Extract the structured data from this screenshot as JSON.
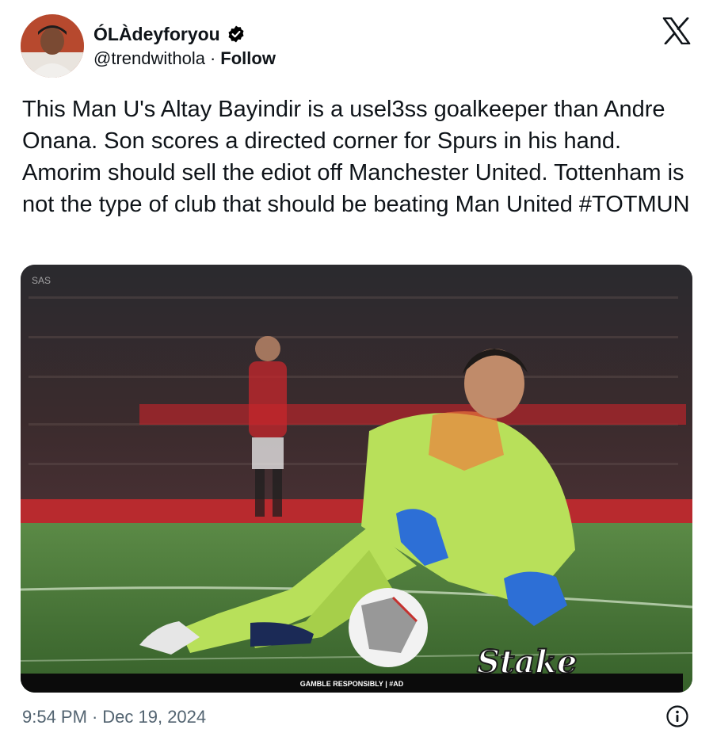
{
  "author": {
    "display_name": "ÓLÀdeyforyou",
    "handle": "@trendwithola",
    "separator": "·",
    "follow_label": "Follow",
    "verified": true,
    "avatar_icon": "user-avatar"
  },
  "tweet": {
    "text": "This Man U's Altay Bayindir is a usel3ss goalkeeper than Andre Onana. Son scores a directed corner for Spurs in his hand. Amorim should sell the ediot off Manchester United. Tottenham is not the type of club that should be beating Man United #TOTMUN"
  },
  "media": {
    "banner_text": "GAMBLE RESPONSIBLY | #AD",
    "brand_logo_text": "Stake",
    "corner_watermark": "SAS"
  },
  "footer": {
    "time": "9:54 PM",
    "date": "Dec 19, 2024",
    "separator": "·"
  },
  "colors": {
    "text": "#0f1419",
    "secondary": "#536471",
    "verified_badge": "#000000",
    "pitch": "#4a7a3a",
    "kit_green": "#b8e05a"
  },
  "icons": {
    "close": "x-logo-icon",
    "verified": "verified-badge-icon",
    "info": "info-icon"
  }
}
